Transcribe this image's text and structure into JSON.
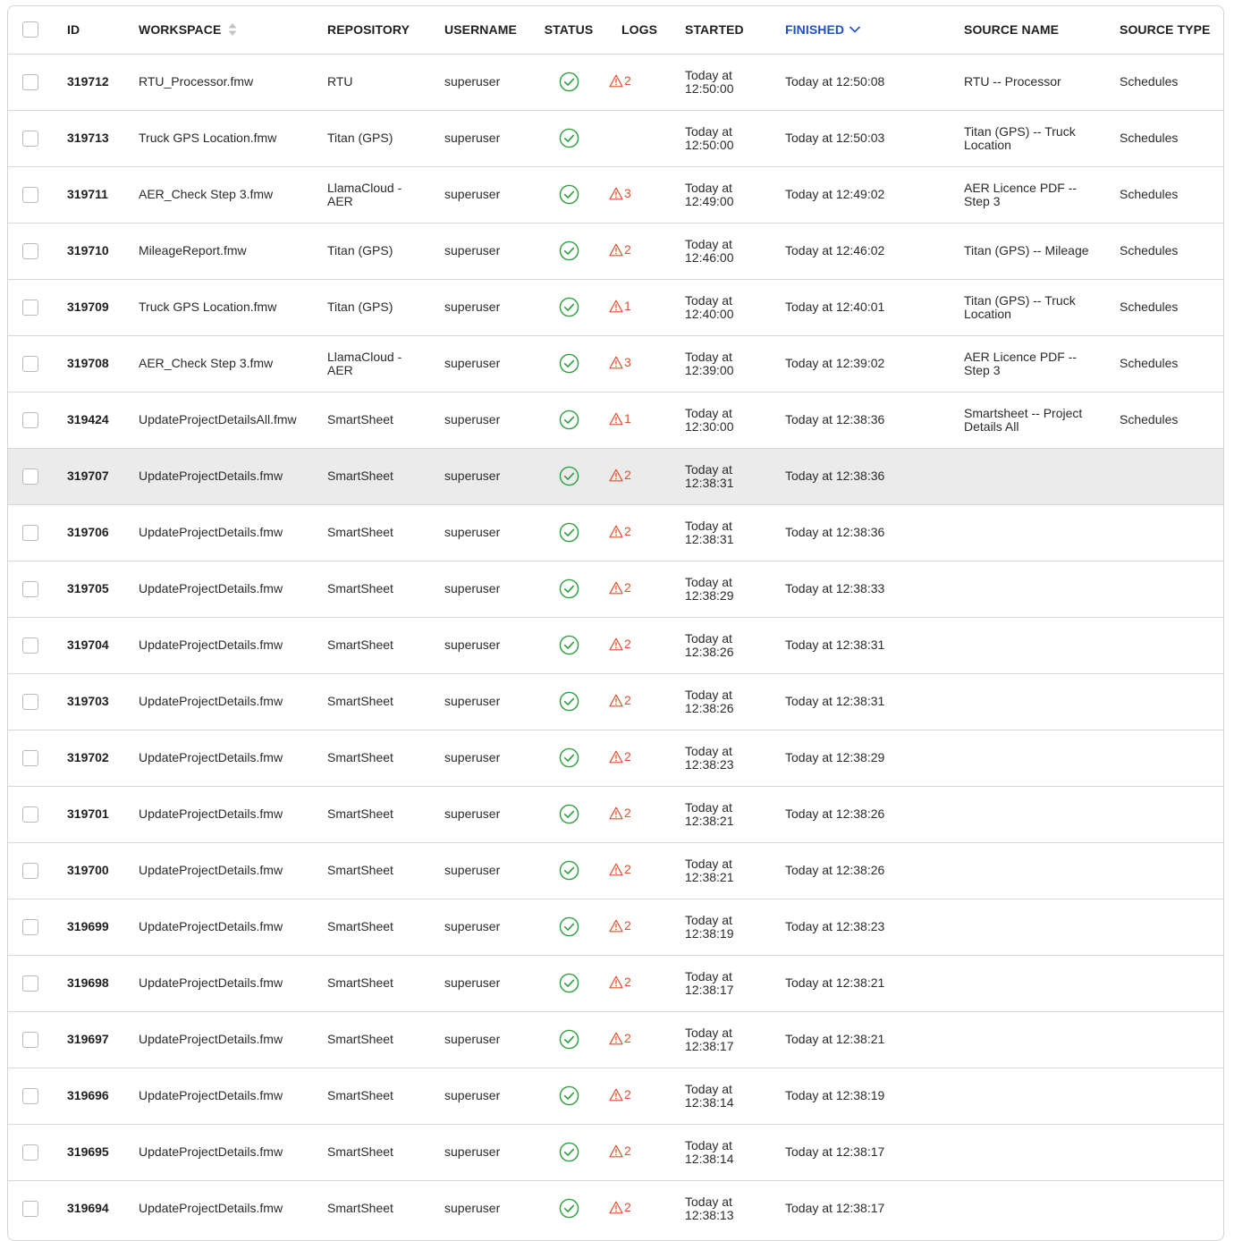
{
  "header": {
    "id": "ID",
    "workspace": "WORKSPACE",
    "repository": "REPOSITORY",
    "username": "USERNAME",
    "status": "STATUS",
    "logs": "LOGS",
    "started": "STARTED",
    "finished": "FINISHED",
    "source_name": "SOURCE NAME",
    "source_type": "SOURCE TYPE"
  },
  "sort": {
    "column": "finished",
    "direction": "descending"
  },
  "colors": {
    "accent": "#1f4fc6",
    "success": "#2e9e3e",
    "warning": "#e0502d",
    "hover_row": "#ebebeb"
  },
  "icons": {
    "status_ok": "check-circle-icon",
    "logs_warning": "warning-triangle-icon",
    "sortable": "sort-icon",
    "sorted": "chevron-down-icon"
  },
  "hovered_row": 7,
  "rows": [
    {
      "id": "319712",
      "workspace": "RTU_Processor.fmw",
      "repository": "RTU",
      "username": "superuser",
      "status": "success",
      "logs": "2",
      "started": "Today at 12:50:00",
      "finished": "Today at 12:50:08",
      "source_name": "RTU -- Processor",
      "source_type": "Schedules"
    },
    {
      "id": "319713",
      "workspace": "Truck GPS Location.fmw",
      "repository": "Titan (GPS)",
      "username": "superuser",
      "status": "success",
      "logs": "",
      "started": "Today at 12:50:00",
      "finished": "Today at 12:50:03",
      "source_name": "Titan (GPS) -- Truck Location",
      "source_type": "Schedules"
    },
    {
      "id": "319711",
      "workspace": "AER_Check Step 3.fmw",
      "repository": "LlamaCloud - AER",
      "username": "superuser",
      "status": "success",
      "logs": "3",
      "started": "Today at 12:49:00",
      "finished": "Today at 12:49:02",
      "source_name": "AER Licence PDF -- Step 3",
      "source_type": "Schedules"
    },
    {
      "id": "319710",
      "workspace": "MileageReport.fmw",
      "repository": "Titan (GPS)",
      "username": "superuser",
      "status": "success",
      "logs": "2",
      "started": "Today at 12:46:00",
      "finished": "Today at 12:46:02",
      "source_name": "Titan (GPS) -- Mileage",
      "source_type": "Schedules"
    },
    {
      "id": "319709",
      "workspace": "Truck GPS Location.fmw",
      "repository": "Titan (GPS)",
      "username": "superuser",
      "status": "success",
      "logs": "1",
      "started": "Today at 12:40:00",
      "finished": "Today at 12:40:01",
      "source_name": "Titan (GPS) -- Truck Location",
      "source_type": "Schedules"
    },
    {
      "id": "319708",
      "workspace": "AER_Check Step 3.fmw",
      "repository": "LlamaCloud - AER",
      "username": "superuser",
      "status": "success",
      "logs": "3",
      "started": "Today at 12:39:00",
      "finished": "Today at 12:39:02",
      "source_name": "AER Licence PDF -- Step 3",
      "source_type": "Schedules"
    },
    {
      "id": "319424",
      "workspace": "UpdateProjectDetailsAll.fmw",
      "repository": "SmartSheet",
      "username": "superuser",
      "status": "success",
      "logs": "1",
      "started": "Today at 12:30:00",
      "finished": "Today at 12:38:36",
      "source_name": "Smartsheet -- Project Details All",
      "source_type": "Schedules"
    },
    {
      "id": "319707",
      "workspace": "UpdateProjectDetails.fmw",
      "repository": "SmartSheet",
      "username": "superuser",
      "status": "success",
      "logs": "2",
      "started": "Today at 12:38:31",
      "finished": "Today at 12:38:36",
      "source_name": "",
      "source_type": ""
    },
    {
      "id": "319706",
      "workspace": "UpdateProjectDetails.fmw",
      "repository": "SmartSheet",
      "username": "superuser",
      "status": "success",
      "logs": "2",
      "started": "Today at 12:38:31",
      "finished": "Today at 12:38:36",
      "source_name": "",
      "source_type": ""
    },
    {
      "id": "319705",
      "workspace": "UpdateProjectDetails.fmw",
      "repository": "SmartSheet",
      "username": "superuser",
      "status": "success",
      "logs": "2",
      "started": "Today at 12:38:29",
      "finished": "Today at 12:38:33",
      "source_name": "",
      "source_type": ""
    },
    {
      "id": "319704",
      "workspace": "UpdateProjectDetails.fmw",
      "repository": "SmartSheet",
      "username": "superuser",
      "status": "success",
      "logs": "2",
      "started": "Today at 12:38:26",
      "finished": "Today at 12:38:31",
      "source_name": "",
      "source_type": ""
    },
    {
      "id": "319703",
      "workspace": "UpdateProjectDetails.fmw",
      "repository": "SmartSheet",
      "username": "superuser",
      "status": "success",
      "logs": "2",
      "started": "Today at 12:38:26",
      "finished": "Today at 12:38:31",
      "source_name": "",
      "source_type": ""
    },
    {
      "id": "319702",
      "workspace": "UpdateProjectDetails.fmw",
      "repository": "SmartSheet",
      "username": "superuser",
      "status": "success",
      "logs": "2",
      "started": "Today at 12:38:23",
      "finished": "Today at 12:38:29",
      "source_name": "",
      "source_type": ""
    },
    {
      "id": "319701",
      "workspace": "UpdateProjectDetails.fmw",
      "repository": "SmartSheet",
      "username": "superuser",
      "status": "success",
      "logs": "2",
      "started": "Today at 12:38:21",
      "finished": "Today at 12:38:26",
      "source_name": "",
      "source_type": ""
    },
    {
      "id": "319700",
      "workspace": "UpdateProjectDetails.fmw",
      "repository": "SmartSheet",
      "username": "superuser",
      "status": "success",
      "logs": "2",
      "started": "Today at 12:38:21",
      "finished": "Today at 12:38:26",
      "source_name": "",
      "source_type": ""
    },
    {
      "id": "319699",
      "workspace": "UpdateProjectDetails.fmw",
      "repository": "SmartSheet",
      "username": "superuser",
      "status": "success",
      "logs": "2",
      "started": "Today at 12:38:19",
      "finished": "Today at 12:38:23",
      "source_name": "",
      "source_type": ""
    },
    {
      "id": "319698",
      "workspace": "UpdateProjectDetails.fmw",
      "repository": "SmartSheet",
      "username": "superuser",
      "status": "success",
      "logs": "2",
      "started": "Today at 12:38:17",
      "finished": "Today at 12:38:21",
      "source_name": "",
      "source_type": ""
    },
    {
      "id": "319697",
      "workspace": "UpdateProjectDetails.fmw",
      "repository": "SmartSheet",
      "username": "superuser",
      "status": "success",
      "logs": "2",
      "started": "Today at 12:38:17",
      "finished": "Today at 12:38:21",
      "source_name": "",
      "source_type": ""
    },
    {
      "id": "319696",
      "workspace": "UpdateProjectDetails.fmw",
      "repository": "SmartSheet",
      "username": "superuser",
      "status": "success",
      "logs": "2",
      "started": "Today at 12:38:14",
      "finished": "Today at 12:38:19",
      "source_name": "",
      "source_type": ""
    },
    {
      "id": "319695",
      "workspace": "UpdateProjectDetails.fmw",
      "repository": "SmartSheet",
      "username": "superuser",
      "status": "success",
      "logs": "2",
      "started": "Today at 12:38:14",
      "finished": "Today at 12:38:17",
      "source_name": "",
      "source_type": ""
    },
    {
      "id": "319694",
      "workspace": "UpdateProjectDetails.fmw",
      "repository": "SmartSheet",
      "username": "superuser",
      "status": "success",
      "logs": "2",
      "started": "Today at 12:38:13",
      "finished": "Today at 12:38:17",
      "source_name": "",
      "source_type": ""
    }
  ]
}
